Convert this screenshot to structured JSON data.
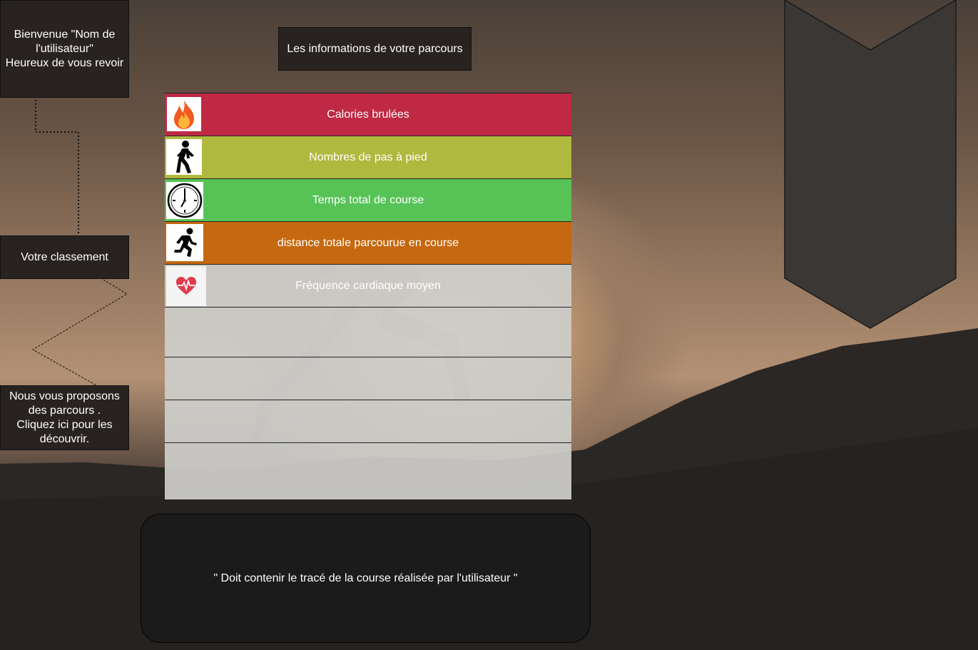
{
  "welcome": {
    "line1": "Bienvenue \"Nom de",
    "line2": "l'utilisateur\"",
    "line3": "Heureux de vous revoir"
  },
  "ranking_label": "Votre classement",
  "routes_label": {
    "line1": "Nous vous proposons",
    "line2": "des parcours .",
    "line3": "Cliquez ici pour les",
    "line4": "découvrir."
  },
  "info_title": "Les informations de votre parcours",
  "stats": [
    {
      "label": "Calories brulées",
      "icon": "fire-icon",
      "color": "#bf2944"
    },
    {
      "label": "Nombres de pas à pied",
      "icon": "walking-icon",
      "color": "#b1b83e"
    },
    {
      "label": "Temps total de course",
      "icon": "clock-icon",
      "color": "#57c357"
    },
    {
      "label": "distance totale parcourue en course",
      "icon": "running-icon",
      "color": "#c5680f"
    },
    {
      "label": "Fréquence cardiaque moyen",
      "icon": "heart-rate-icon",
      "color": "#cdcdca"
    }
  ],
  "map_placeholder": "\" Doit contenir le tracé de la course réalisée par l'utilisateur \""
}
